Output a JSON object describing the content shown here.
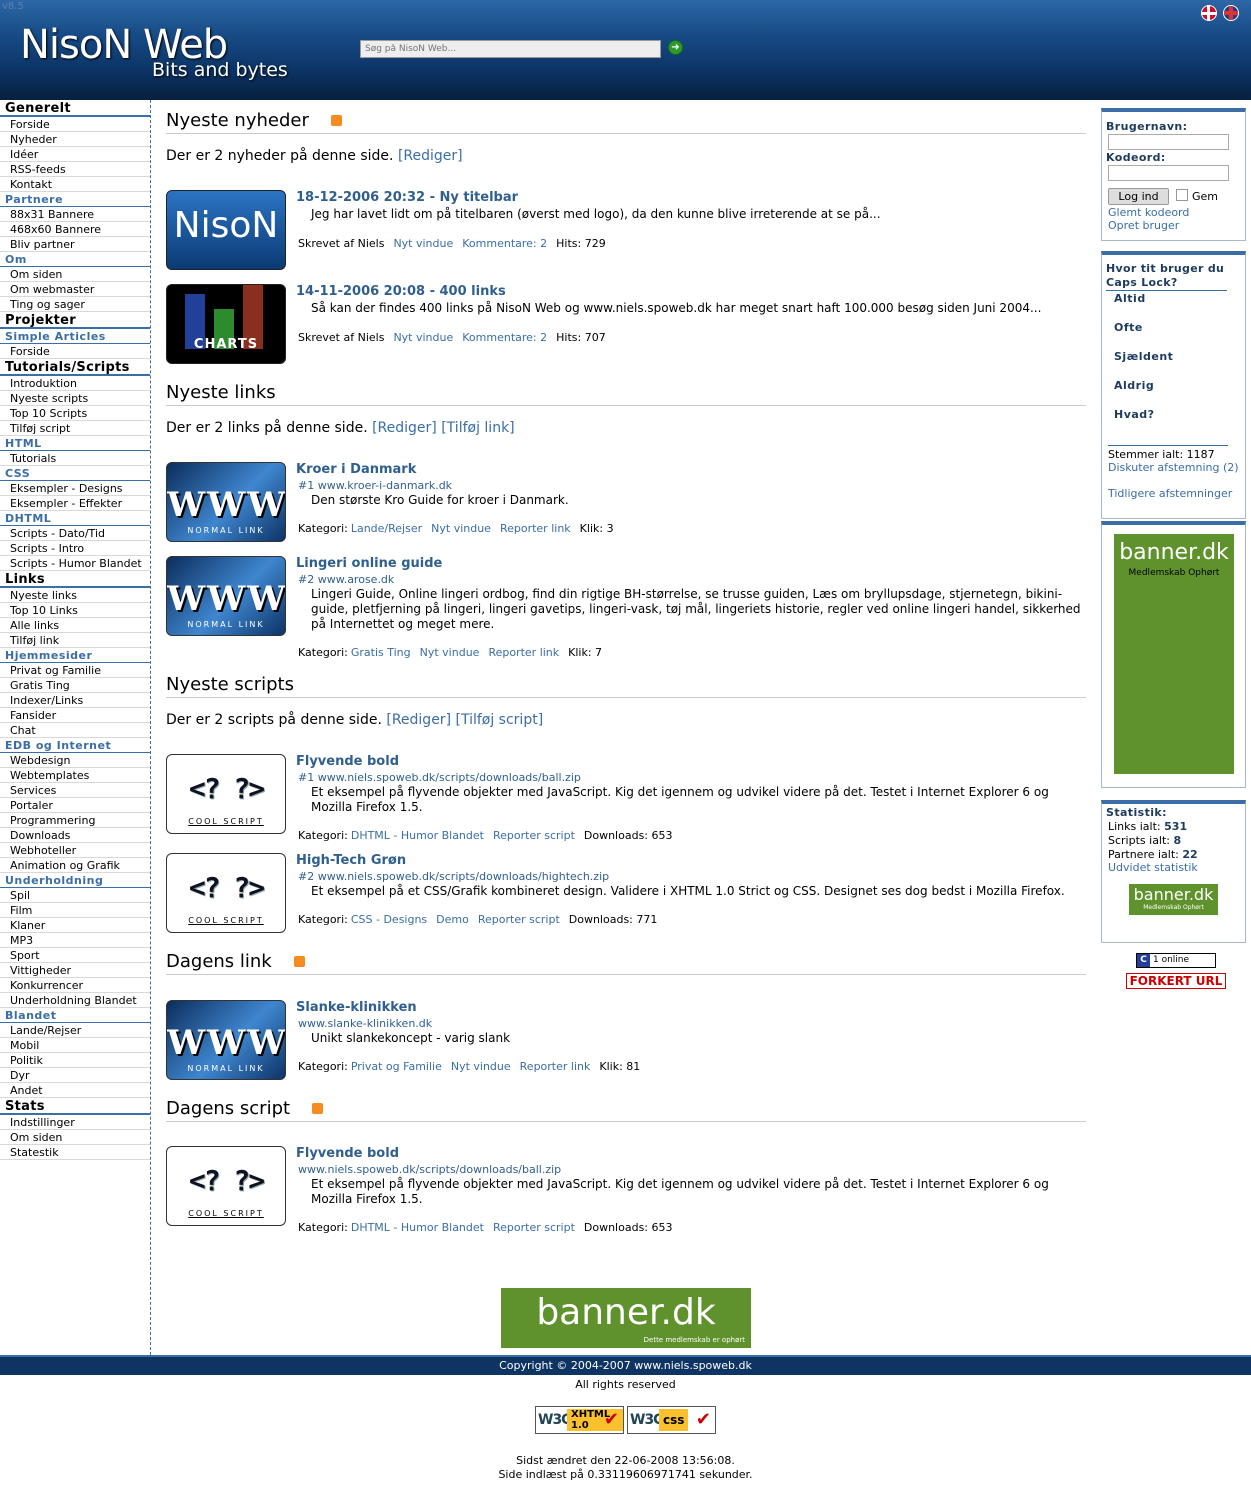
{
  "header": {
    "version": "v8.5",
    "logo_main": "NisoN Web",
    "logo_sub": "Bits and bytes",
    "search_placeholder": "Søg på NisoN Web..."
  },
  "sidebar": [
    {
      "type": "section",
      "label": "Generelt"
    },
    {
      "type": "item",
      "label": "Forside"
    },
    {
      "type": "item",
      "label": "Nyheder"
    },
    {
      "type": "item",
      "label": "Idéer"
    },
    {
      "type": "item",
      "label": "RSS-feeds"
    },
    {
      "type": "item",
      "label": "Kontakt"
    },
    {
      "type": "sub",
      "label": "Partnere"
    },
    {
      "type": "item",
      "label": "88x31 Bannere"
    },
    {
      "type": "item",
      "label": "468x60 Bannere"
    },
    {
      "type": "item",
      "label": "Bliv partner"
    },
    {
      "type": "sub",
      "label": "Om"
    },
    {
      "type": "item",
      "label": "Om siden"
    },
    {
      "type": "item",
      "label": "Om webmaster"
    },
    {
      "type": "item",
      "label": "Ting og sager"
    },
    {
      "type": "section",
      "label": "Projekter"
    },
    {
      "type": "sub",
      "label": "Simple Articles"
    },
    {
      "type": "item",
      "label": "Forside"
    },
    {
      "type": "section",
      "label": "Tutorials/Scripts"
    },
    {
      "type": "item",
      "label": "Introduktion"
    },
    {
      "type": "item",
      "label": "Nyeste scripts"
    },
    {
      "type": "item",
      "label": "Top 10 Scripts"
    },
    {
      "type": "item",
      "label": "Tilføj script"
    },
    {
      "type": "sub",
      "label": "HTML"
    },
    {
      "type": "item",
      "label": "Tutorials"
    },
    {
      "type": "sub",
      "label": "CSS"
    },
    {
      "type": "item",
      "label": "Eksempler - Designs"
    },
    {
      "type": "item",
      "label": "Eksempler - Effekter"
    },
    {
      "type": "sub",
      "label": "DHTML"
    },
    {
      "type": "item",
      "label": "Scripts - Dato/Tid"
    },
    {
      "type": "item",
      "label": "Scripts - Intro"
    },
    {
      "type": "item",
      "label": "Scripts - Humor Blandet"
    },
    {
      "type": "section",
      "label": "Links"
    },
    {
      "type": "item",
      "label": "Nyeste links"
    },
    {
      "type": "item",
      "label": "Top 10 Links"
    },
    {
      "type": "item",
      "label": "Alle links"
    },
    {
      "type": "item",
      "label": "Tilføj link"
    },
    {
      "type": "sub",
      "label": "Hjemmesider"
    },
    {
      "type": "item",
      "label": "Privat og Familie"
    },
    {
      "type": "item",
      "label": "Gratis Ting"
    },
    {
      "type": "item",
      "label": "Indexer/Links"
    },
    {
      "type": "item",
      "label": "Fansider"
    },
    {
      "type": "item",
      "label": "Chat"
    },
    {
      "type": "sub",
      "label": "EDB og Internet"
    },
    {
      "type": "item",
      "label": "Webdesign"
    },
    {
      "type": "item",
      "label": "Webtemplates"
    },
    {
      "type": "item",
      "label": "Services"
    },
    {
      "type": "item",
      "label": "Portaler"
    },
    {
      "type": "item",
      "label": "Programmering"
    },
    {
      "type": "item",
      "label": "Downloads"
    },
    {
      "type": "item",
      "label": "Webhoteller"
    },
    {
      "type": "item",
      "label": "Animation og Grafik"
    },
    {
      "type": "sub",
      "label": "Underholdning"
    },
    {
      "type": "item",
      "label": "Spil"
    },
    {
      "type": "item",
      "label": "Film"
    },
    {
      "type": "item",
      "label": "Klaner"
    },
    {
      "type": "item",
      "label": "MP3"
    },
    {
      "type": "item",
      "label": "Sport"
    },
    {
      "type": "item",
      "label": "Vittigheder"
    },
    {
      "type": "item",
      "label": "Konkurrencer"
    },
    {
      "type": "item",
      "label": "Underholdning Blandet"
    },
    {
      "type": "sub",
      "label": "Blandet"
    },
    {
      "type": "item",
      "label": "Lande/Rejser"
    },
    {
      "type": "item",
      "label": "Mobil"
    },
    {
      "type": "item",
      "label": "Politik"
    },
    {
      "type": "item",
      "label": "Dyr"
    },
    {
      "type": "item",
      "label": "Andet"
    },
    {
      "type": "section",
      "label": "Stats"
    },
    {
      "type": "item",
      "label": "Indstillinger"
    },
    {
      "type": "item",
      "label": "Om siden"
    },
    {
      "type": "item",
      "label": "Statestik"
    }
  ],
  "news": {
    "heading": "Nyeste nyheder",
    "intro": "Der er 2 nyheder på denne side.",
    "edit": "[Rediger]",
    "items": [
      {
        "title": "18-12-2006 20:32 - Ny titelbar",
        "thumb": "NisoN",
        "desc": "Jeg har lavet lidt om på titelbaren (øverst med logo), da den kunne blive irreterende at se på...",
        "author": "Skrevet af Niels",
        "new_window": "Nyt vindue",
        "comments": "Kommentare: 2",
        "hits": "Hits: 729"
      },
      {
        "title": "14-11-2006 20:08 - 400 links",
        "thumb": "CHARTS",
        "desc": "Så kan der findes 400 links på NisoN Web og www.niels.spoweb.dk har meget snart haft 100.000 besøg siden Juni 2004...",
        "author": "Skrevet af Niels",
        "new_window": "Nyt vindue",
        "comments": "Kommentare: 2",
        "hits": "Hits: 707"
      }
    ]
  },
  "links": {
    "heading": "Nyeste links",
    "intro": "Der er 2 links på denne side.",
    "edit": "[Rediger]",
    "add": "[Tilføj link]",
    "items": [
      {
        "title": "Kroer i Danmark",
        "url": "#1 www.kroer-i-danmark.dk",
        "desc": "Den største Kro Guide for kroer i Danmark.",
        "category_label": "Kategori:",
        "category": "Lande/Rejser",
        "new_window": "Nyt vindue",
        "report": "Reporter link",
        "clicks": "Klik: 3"
      },
      {
        "title": "Lingeri online guide",
        "url": "#2 www.arose.dk",
        "desc": "Lingeri Guide, Online lingeri ordbog, find din rigtige BH-størrelse, se trusse guiden, Læs om bryllupsdage, stjernetegn, bikini-guide, pletfjerning på lingeri, lingeri gavetips, lingeri-vask, tøj mål, lingeriets historie, regler ved online lingeri handel, sikkerhed på Internettet og meget mere.",
        "category_label": "Kategori:",
        "category": "Gratis Ting",
        "new_window": "Nyt vindue",
        "report": "Reporter link",
        "clicks": "Klik: 7"
      }
    ]
  },
  "scripts": {
    "heading": "Nyeste scripts",
    "intro": "Der er 2 scripts på denne side.",
    "edit": "[Rediger]",
    "add": "[Tilføj script]",
    "items": [
      {
        "title": "Flyvende bold",
        "url": "#1 www.niels.spoweb.dk/scripts/downloads/ball.zip",
        "desc": "Et eksempel på flyvende objekter med JavaScript. Kig det igennem og udvikel videre på det. Testet i Internet Explorer 6 og Mozilla Firefox 1.5.",
        "category_label": "Kategori:",
        "category": "DHTML - Humor Blandet",
        "report": "Reporter script",
        "downloads": "Downloads: 653"
      },
      {
        "title": "High-Tech Grøn",
        "url": "#2 www.niels.spoweb.dk/scripts/downloads/hightech.zip",
        "desc": "Et eksempel på et CSS/Grafik kombineret design. Validere i XHTML 1.0 Strict og CSS. Designet ses dog bedst i Mozilla Firefox.",
        "category_label": "Kategori:",
        "category": "CSS - Designs",
        "demo": "Demo",
        "report": "Reporter script",
        "downloads": "Downloads: 771"
      }
    ]
  },
  "daily_link": {
    "heading": "Dagens link",
    "title": "Slanke-klinikken",
    "url": "www.slanke-klinikken.dk",
    "desc": "Unikt slankekoncept - varig slank",
    "category_label": "Kategori:",
    "category": "Privat og Familie",
    "new_window": "Nyt vindue",
    "report": "Reporter link",
    "clicks": "Klik: 81"
  },
  "daily_script": {
    "heading": "Dagens script",
    "title": "Flyvende bold",
    "url": "www.niels.spoweb.dk/scripts/downloads/ball.zip",
    "desc": "Et eksempel på flyvende objekter med JavaScript. Kig det igennem og udvikel videre på det. Testet i Internet Explorer 6 og Mozilla Firefox 1.5.",
    "category_label": "Kategori:",
    "category": "DHTML - Humor Blandet",
    "report": "Reporter script",
    "downloads": "Downloads: 653"
  },
  "thumbs": {
    "www": "WWW",
    "www_cap": "NORMAL LINK",
    "script": "<? ?>",
    "script_cap": "COOL SCRIPT"
  },
  "login": {
    "username_label": "Brugernavn:",
    "password_label": "Kodeord:",
    "login_button": "Log ind",
    "remember_label": "Gem",
    "forgot": "Glemt kodeord",
    "create": "Opret bruger"
  },
  "poll": {
    "question": "Hvor tit bruger du Caps Lock?",
    "options": [
      "Altid",
      "Ofte",
      "Sjældent",
      "Aldrig",
      "Hvad?"
    ],
    "total": "Stemmer ialt: 1187",
    "discuss": "Diskuter afstemning (2)",
    "previous": "Tidligere afstemninger"
  },
  "banner": {
    "name": "banner.dk",
    "status": "Medlemskab Ophørt",
    "status_small": "Dette medlemskab er ophørt"
  },
  "stats": {
    "heading": "Statistik:",
    "links_label": "Links ialt:",
    "links": "531",
    "scripts_label": "Scripts ialt:",
    "scripts": "8",
    "partners_label": "Partnere ialt:",
    "partners": "22",
    "extended": "Udvidet statistik"
  },
  "counter": {
    "icon": "C",
    "online": "1 online"
  },
  "wrong_url": "FORKERT URL",
  "footer": {
    "copyright": "Copyright © 2004-2007 www.niels.spoweb.dk",
    "rights": "All rights reserved",
    "w3c_xhtml": "XHTML 1.0",
    "w3c_css": "css",
    "w3c": "W3C",
    "modified": "Sidst ændret den 22-06-2008 13:56:08.",
    "loaded": "Side indlæst på 0.33119606971741 sekunder."
  },
  "colors": {
    "accent": "#3a6ea5",
    "header_dark": "#0e3463",
    "banner_green": "#5f922c",
    "rss": "#f68c1f"
  }
}
